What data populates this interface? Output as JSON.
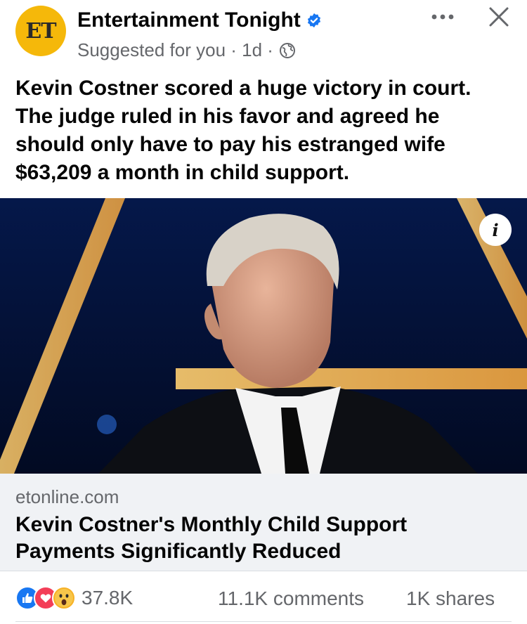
{
  "page": {
    "name": "Entertainment Tonight",
    "avatar_text": "ET",
    "meta_text": "Suggested for you · 1d ·",
    "icons": {
      "verified": "verified-badge-icon",
      "globe": "globe-icon",
      "more": "more-options-icon",
      "close": "close-icon",
      "info": "info-icon"
    }
  },
  "post": {
    "text": "Kevin Costner scored a huge victory in court. The judge ruled in his favor and agreed he should only have to pay his estranged wife $63,209 a month in child support."
  },
  "link": {
    "domain": "etonline.com",
    "title": "Kevin Costner's Monthly Child Support Payments Significantly Reduced",
    "info_glyph": "i"
  },
  "footer": {
    "reaction_count": "37.8K",
    "comments": "11.1K comments",
    "shares": "1K shares"
  },
  "colors": {
    "accent": "#1877f2",
    "avatar": "#f5b80a",
    "love": "#f33e58",
    "wow": "#f7b125"
  }
}
